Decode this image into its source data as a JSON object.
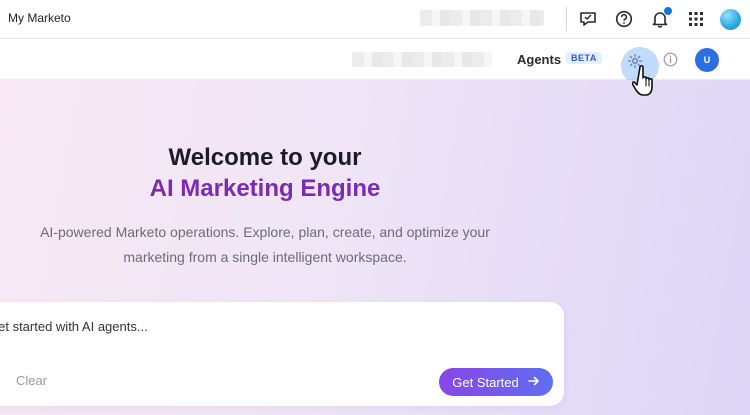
{
  "topbar": {
    "app_title": "My Marketo",
    "icons": [
      "feedback-icon",
      "help-icon",
      "notification-icon",
      "apps-grid-icon",
      "profile-icon"
    ]
  },
  "subbar": {
    "agents_label": "Agents",
    "beta_badge": "BETA",
    "avatar_initial": "U"
  },
  "hero": {
    "title_line1": "Welcome to your",
    "title_line2": "AI Marketing Engine",
    "description_line1": "AI-powered Marketo operations. Explore, plan, create, and optimize your",
    "description_line2": "marketing from a single intelligent workspace."
  },
  "prompt": {
    "placeholder": "Get started with AI agents...",
    "clear_label": "Clear",
    "get_started_label": "Get Started"
  },
  "colors": {
    "accent_purple": "#7b2bb0",
    "button_gradient_start": "#8a45e6",
    "button_gradient_end": "#5d6ff0",
    "avatar_blue": "#2b6fe0"
  }
}
